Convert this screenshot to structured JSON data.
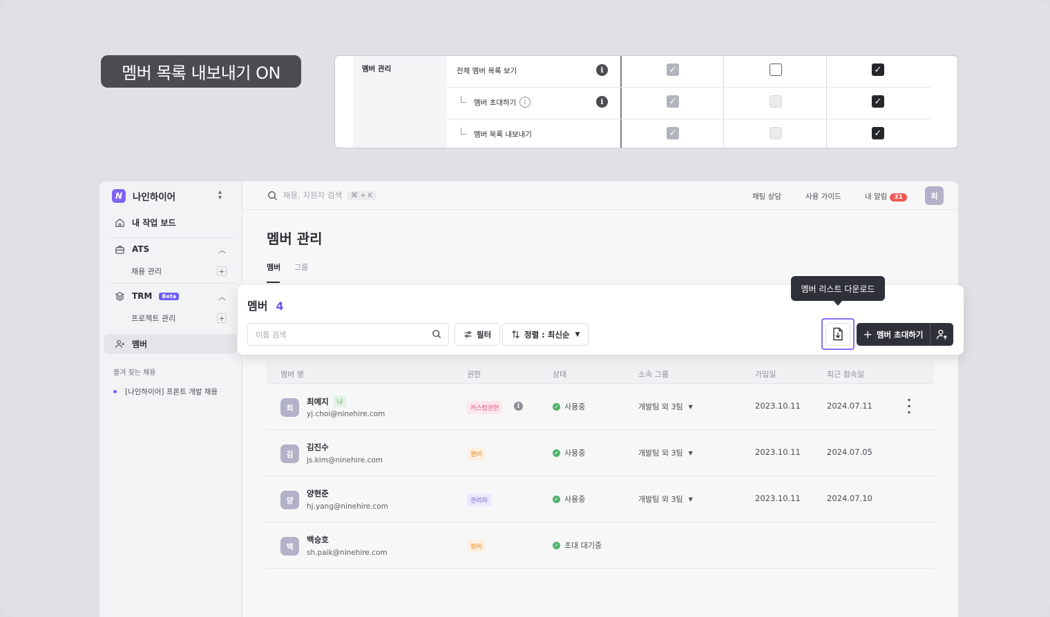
{
  "badge": "멤버 목록 내보내기 ON",
  "permissions": {
    "group": "멤버 관리",
    "rows": [
      {
        "label": "전체 멤버 목록 보기",
        "col1": "checked-grey",
        "col2": "empty",
        "col3": "checked-dark"
      },
      {
        "label": "멤버 초대하기",
        "col1": "checked-grey",
        "col2": "disabled",
        "col3": "checked-dark"
      },
      {
        "label": "멤버 목록 내보내기",
        "col1": "checked-grey",
        "col2": "disabled",
        "col3": "checked-dark"
      }
    ]
  },
  "workspace": {
    "logo": "N",
    "name": "나인하이어"
  },
  "sidebar": {
    "dashboard": "내 작업 보드",
    "ats": "ATS",
    "ats_sub": "채용 관리",
    "trm": "TRM",
    "trm_badge": "Beta",
    "trm_sub": "프로젝트 관리",
    "member": "멤버",
    "fav_header": "즐겨 찾는 채용",
    "fav_item": "[나인하이어] 프론트 개발 채용"
  },
  "topbar": {
    "search_placeholder": "채용, 지원자 검색",
    "shortcut": "⌘ + K",
    "chat": "채팅 상담",
    "guide": "사용 가이드",
    "alerts": "내 알림",
    "alert_count": "31",
    "avatar": "최"
  },
  "page": {
    "title": "멤버 관리",
    "tab_member": "멤버",
    "tab_group": "그룹"
  },
  "card": {
    "title": "멤버",
    "count": "4",
    "search_placeholder": "이름 검색",
    "filter": "필터",
    "sort": "정렬 : 최신순",
    "invite": "멤버 초대하기",
    "tooltip": "멤버 리스트 다운로드"
  },
  "table": {
    "headers": [
      "멤버 명",
      "권한",
      "상태",
      "소속 그룹",
      "가입일",
      "최근 접속일"
    ],
    "rows": [
      {
        "initial": "최",
        "name": "최예지",
        "me": "나",
        "email": "yj.choi@ninehire.com",
        "role": "커스텀권한",
        "role_type": "custom",
        "status": "사용중",
        "group": "개발팀 외 3팀",
        "joined": "2023.10.11",
        "last": "2024.07.11"
      },
      {
        "initial": "김",
        "name": "김진수",
        "me": "",
        "email": "js.kim@ninehire.com",
        "role": "멤버",
        "role_type": "member",
        "status": "사용중",
        "group": "개발팀 외 3팀",
        "joined": "2023.10.11",
        "last": "2024.07.05"
      },
      {
        "initial": "양",
        "name": "양현준",
        "me": "",
        "email": "hj.yang@ninehire.com",
        "role": "관리자",
        "role_type": "admin",
        "status": "사용중",
        "group": "개발팀 외 3팀",
        "joined": "2023.10.11",
        "last": "2024.07.10"
      },
      {
        "initial": "백",
        "name": "백승호",
        "me": "",
        "email": "sh.paik@ninehire.com",
        "role": "멤버",
        "role_type": "member",
        "status": "초대 대기중",
        "group": "",
        "joined": "",
        "last": ""
      }
    ]
  },
  "colors": {
    "accent": "#6f53f2",
    "dark": "#2e3138",
    "ok": "#52b36b"
  }
}
